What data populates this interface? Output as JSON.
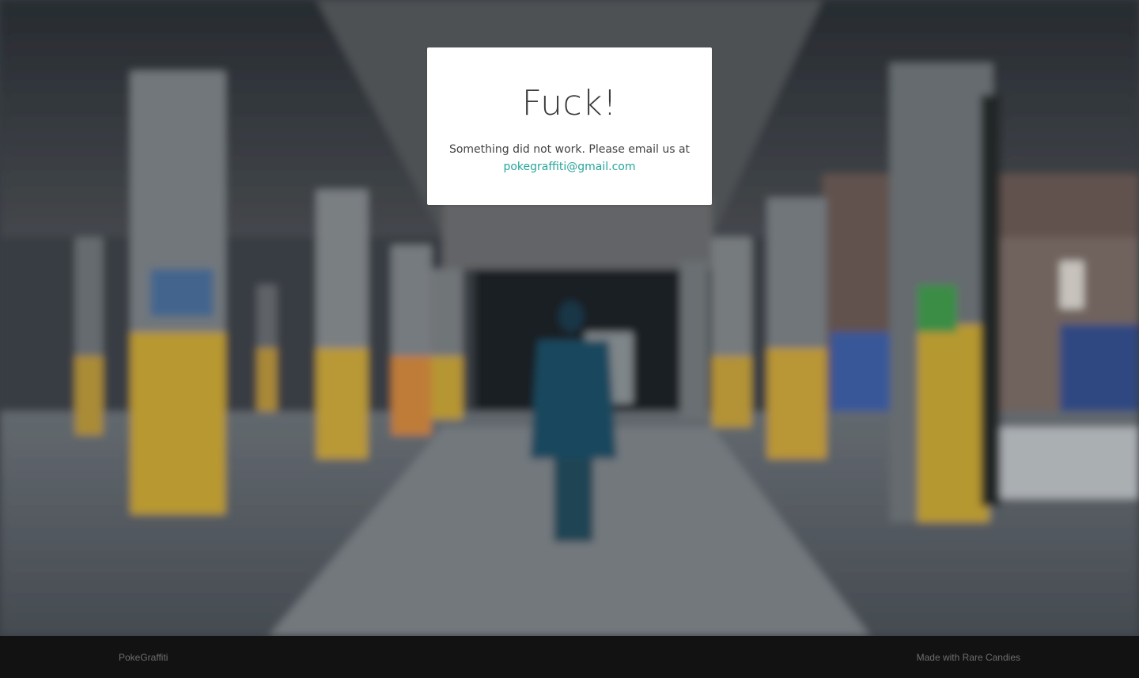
{
  "error": {
    "title": "Fuck!",
    "message": "Something did not work. Please email us at",
    "email": "pokegraffiti@gmail.com"
  },
  "footer": {
    "brand": "PokeGraffiti",
    "credit": "Made with Rare Candies"
  },
  "colors": {
    "link": "#26a59a",
    "footer_bg": "#121212",
    "card_bg": "#ffffff"
  },
  "background": {
    "description_icon": "abandoned-warehouse-graffiti-photo"
  }
}
